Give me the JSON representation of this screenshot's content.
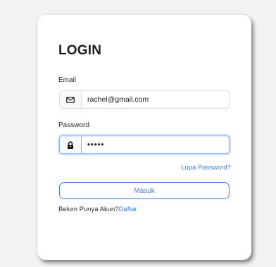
{
  "login": {
    "title": "LOGIN",
    "email_label": "Email",
    "email_value": "rachel@gmail.com",
    "email_icon": "envelope-icon",
    "password_label": "Password",
    "password_value": "•••••",
    "password_icon": "lock-icon",
    "forgot_link": "Lupa Password?",
    "submit_label": "Masuk",
    "signup_prompt": "Belum Punya Akun?",
    "signup_link": "Daftar"
  },
  "colors": {
    "accent": "#3d7de6",
    "focus_border": "#86b7fe",
    "background": "#f1f2f3"
  }
}
